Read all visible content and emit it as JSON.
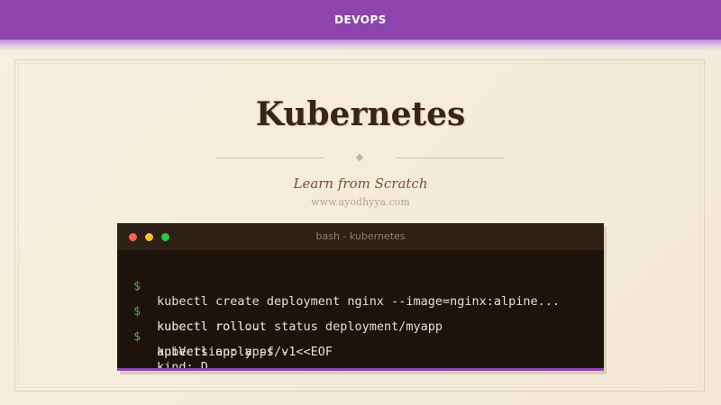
{
  "header": {
    "category": "DEVOPS"
  },
  "course": {
    "title": "Kubernetes",
    "subtitle": "Learn from Scratch",
    "site": "www.ayodhyya.com"
  },
  "terminal": {
    "window_title": "bash - kubernetes",
    "prompt_symbol": "$",
    "lines": [
      "kubectl create deployment nginx --image=nginx:alpine...",
      "kubectl rollout status deployment/myapp",
      "kubectl roll...",
      "kubectl apply -f - <<EOF",
      "apiVersion: apps/v1",
      "kind: D..."
    ]
  },
  "colors": {
    "header_bg": "#8d44ad",
    "prompt": "#4caf50",
    "terminal_bg": "#1e130b",
    "title_text": "#3a2414"
  }
}
